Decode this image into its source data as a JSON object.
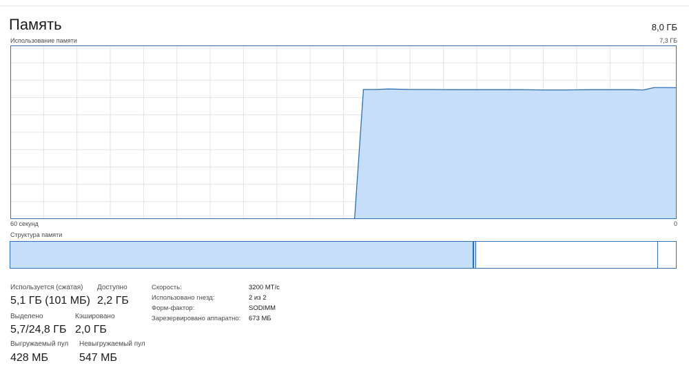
{
  "header": {
    "title": "Память",
    "total": "8,0 ГБ",
    "usage_label": "Использование памяти",
    "usage_max": "7,3 ГБ"
  },
  "chart": {
    "time_left": "60 секунд",
    "time_right": "0",
    "line_color": "#2c6fb3",
    "fill_color": "#c7defa",
    "grid_color": "#e3e3e3"
  },
  "chart_data": {
    "type": "area",
    "xlabel": "",
    "ylabel": "",
    "xlim": [
      60,
      0
    ],
    "ylim": [
      0,
      7.3
    ],
    "x": [
      60,
      29,
      28.2,
      27,
      26,
      24,
      22,
      20,
      18,
      16,
      14,
      12,
      10,
      8,
      6,
      4,
      3,
      2,
      1,
      0
    ],
    "values": [
      0,
      0,
      5.45,
      5.45,
      5.47,
      5.45,
      5.45,
      5.44,
      5.44,
      5.44,
      5.44,
      5.43,
      5.43,
      5.44,
      5.44,
      5.44,
      5.43,
      5.53,
      5.53,
      5.52
    ],
    "grid": true
  },
  "composition": {
    "label": "Структура памяти",
    "segments_gb": {
      "in_use": 5.1,
      "modified": 0.02,
      "standby": 2.0,
      "free": 0.2
    }
  },
  "stats": {
    "in_use_label": "Используется (сжатая)",
    "in_use_value": "5,1 ГБ (101 МБ)",
    "available_label": "Доступно",
    "available_value": "2,2 ГБ",
    "committed_label": "Выделено",
    "committed_value": "5,7/24,8 ГБ",
    "cached_label": "Кэшировано",
    "cached_value": "2,0 ГБ",
    "paged_label": "Выгружаемый пул",
    "paged_value": "428 МБ",
    "nonpaged_label": "Невыгружаемый пул",
    "nonpaged_value": "547 МБ"
  },
  "details": {
    "speed_label": "Скорость:",
    "speed_value": "3200 МТ/с",
    "slots_label": "Использовано гнезд:",
    "slots_value": "2 из 2",
    "form_label": "Форм-фактор:",
    "form_value": "SODIMM",
    "reserved_label": "Зарезервировано аппаратно:",
    "reserved_value": "673 МБ"
  }
}
